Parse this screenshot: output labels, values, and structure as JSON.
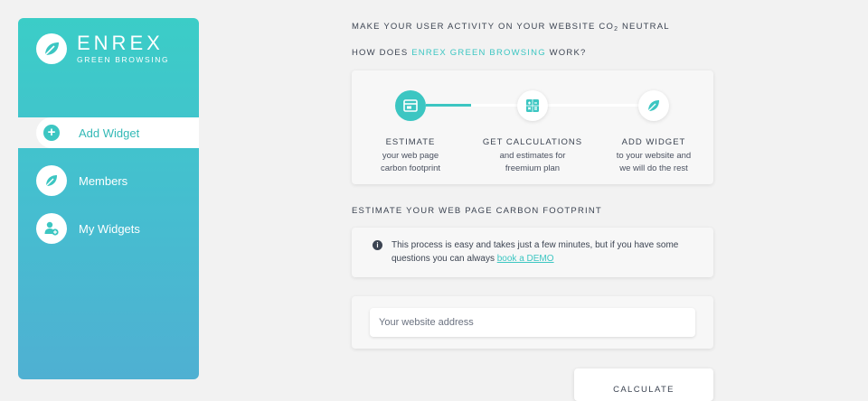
{
  "brand": {
    "name": "ENREX",
    "subtitle": "GREEN BROWSING"
  },
  "sidebar": {
    "items": [
      {
        "label": "Add Widget",
        "icon": "plus-icon",
        "active": true
      },
      {
        "label": "Members",
        "icon": "leaf-icon",
        "active": false
      },
      {
        "label": "My Widgets",
        "icon": "user-add-icon",
        "active": false
      }
    ]
  },
  "main": {
    "heading1": {
      "prefix": "MAKE YOUR USER ACTIVITY ON YOUR WEBSITE CO",
      "sub": "2",
      "suffix": " NEUTRAL"
    },
    "heading2": {
      "prefix": "HOW DOES ",
      "accent": "ENREX GREEN BROWSING",
      "suffix": " WORK?"
    },
    "steps": [
      {
        "title": "ESTIMATE",
        "line1": "your web page",
        "line2": "carbon footprint",
        "icon": "browser-icon"
      },
      {
        "title": "GET CALCULATIONS",
        "line1": "and estimates for",
        "line2": "freemium plan",
        "icon": "calculator-icon"
      },
      {
        "title": "ADD WIDGET",
        "line1": "to your website and",
        "line2": "we will do the rest",
        "icon": "leaf-icon"
      }
    ],
    "heading3": "ESTIMATE YOUR WEB PAGE CARBON FOOTPRINT",
    "info": {
      "line1": "This process is easy and takes just a few minutes, but if you have some",
      "line2_prefix": "questions you can always ",
      "link": "book a DEMO"
    },
    "input": {
      "placeholder": "Your website address",
      "value": ""
    },
    "button": "CALCULATE"
  },
  "colors": {
    "accent": "#3cc6c2",
    "sidebar_top": "#3bcdc7",
    "sidebar_bottom": "#4fb0d2",
    "text": "#3c4452",
    "background": "#f2f2f2"
  }
}
